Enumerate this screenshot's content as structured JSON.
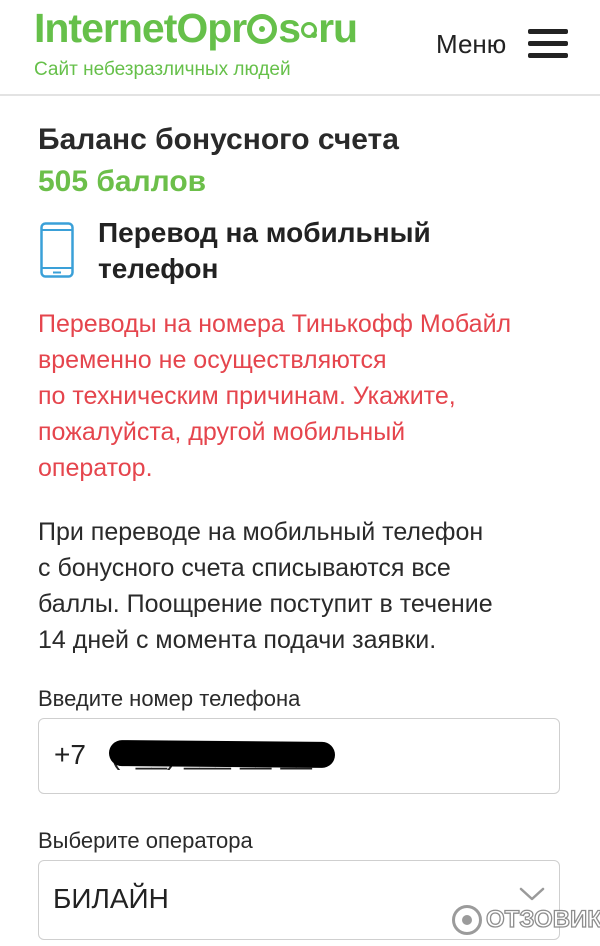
{
  "header": {
    "logo": {
      "part1": "Internet",
      "part2": "Opr",
      "part3": "s",
      "part4": "ru"
    },
    "tagline": "Сайт небезразличных людей",
    "menu_label": "Меню",
    "menu_icon": "hamburger-icon"
  },
  "balance": {
    "title": "Баланс бонусного счета",
    "value": "505 баллов"
  },
  "transfer": {
    "icon": "mobile-phone-icon",
    "title": "Перевод на мобильный телефон"
  },
  "warning": {
    "line1": "Переводы на номера Тинькофф Мобайл",
    "line2": "временно не осуществляются",
    "line3": "по техническим причинам. Укажите,",
    "line4": "пожалуйста, другой мобильный",
    "line5": "оператор."
  },
  "info": {
    "line1": "При переводе на мобильный телефон",
    "line2": "с бонусного счета списываются все",
    "line3": "баллы. Поощрение поступит в течение",
    "line4": "14 дней с момента подачи заявки."
  },
  "phone_field": {
    "label": "Введите номер телефона",
    "prefix": "+7",
    "value": "(9__) ___-__-__",
    "redacted": true
  },
  "operator_field": {
    "label": "Выберите оператора",
    "selected": "БИЛАЙН",
    "chevron_icon": "chevron-down-icon"
  },
  "watermark": {
    "text": "ОТЗОВИК"
  },
  "colors": {
    "brand_green": "#66c04a",
    "warning_red": "#e5454d",
    "phone_icon_blue": "#3aa0d8",
    "text_dark": "#222222"
  }
}
